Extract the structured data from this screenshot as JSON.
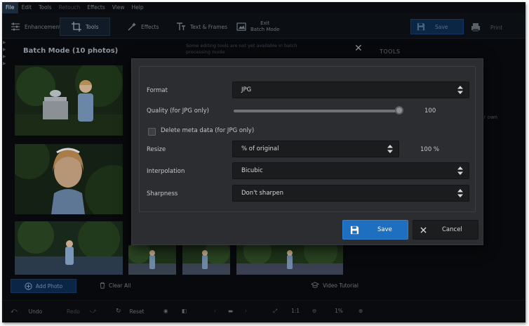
{
  "menu": [
    {
      "label": "File",
      "state": "active"
    },
    {
      "label": "Edit",
      "state": "normal"
    },
    {
      "label": "Tools",
      "state": "normal"
    },
    {
      "label": "Retouch",
      "state": "disabled"
    },
    {
      "label": "Effects",
      "state": "normal"
    },
    {
      "label": "View",
      "state": "normal"
    },
    {
      "label": "Help",
      "state": "normal"
    }
  ],
  "toolbar": {
    "enhancement": "Enhancement",
    "tools": "Tools",
    "effects": "Effects",
    "text_frames": "Text & Frames",
    "exit_line1": "Exit",
    "exit_line2": "Batch Mode",
    "save": "Save",
    "print": "Print"
  },
  "batch": {
    "title": "Batch Mode (10 photos)"
  },
  "right_panel": {
    "tools_label": "TOOLS",
    "notice": "Some editing tools are not yet available in batch processing mode",
    "your_own": "ur own"
  },
  "bottom": {
    "add_photo": "Add Photo",
    "clear_all": "Clear All",
    "video_tutorial": "Video Tutorial"
  },
  "statusbar": {
    "undo": "Undo",
    "redo": "Redo",
    "reset": "Reset",
    "ratio": "1:1",
    "zoom": "1%"
  },
  "dialog": {
    "format_label": "Format",
    "format_value": "JPG",
    "quality_label": "Quality (for JPG only)",
    "quality_value": "100",
    "quality_fraction": 1.0,
    "delete_meta_label": "Delete meta data (for JPG only)",
    "delete_meta_checked": false,
    "resize_label": "Resize",
    "resize_value": "% of original",
    "resize_percent": "100 %",
    "interpolation_label": "Interpolation",
    "interpolation_value": "Bicubic",
    "sharpness_label": "Sharpness",
    "sharpness_value": "Don't sharpen",
    "save_label": "Save",
    "cancel_label": "Cancel"
  },
  "colors": {
    "accent": "#1f6fc1",
    "dialog_bg": "#2b2d30",
    "app_bg": "#07090c"
  }
}
